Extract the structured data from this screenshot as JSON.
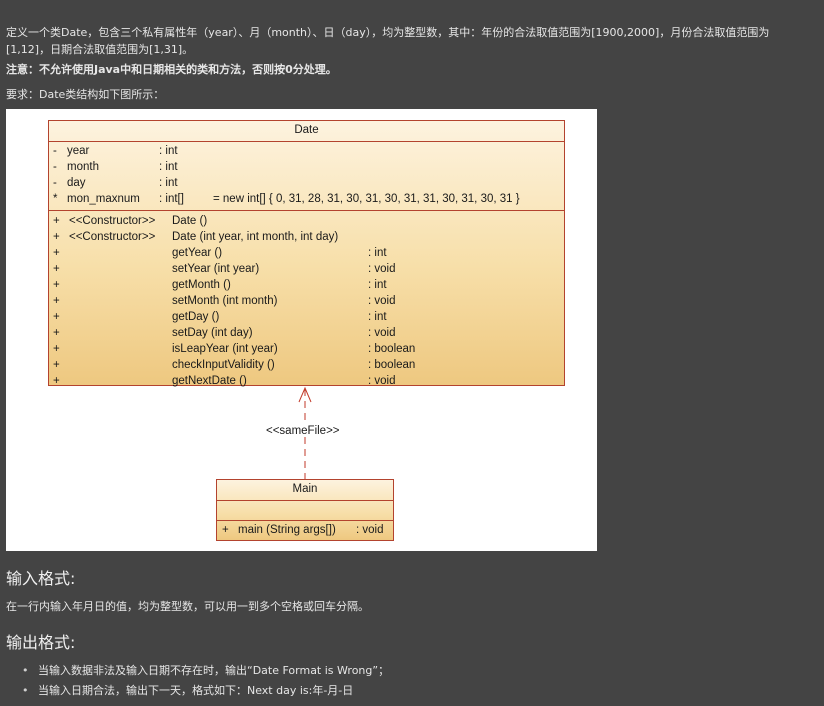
{
  "description": {
    "intro": "定义一个类Date，包含三个私有属性年（year）、月（month）、日（day），均为整型数，其中：年份的合法取值范围为[1900,2000]，月份合法取值范围为[1,12]，日期合法取值范围为[1,31]。",
    "note": "注意：不允许使用Java中和日期相关的类和方法，否则按0分处理。",
    "requirement": "要求：Date类结构如下图所示："
  },
  "diagram": {
    "date_class": {
      "title": "Date",
      "attributes": [
        {
          "vis": "-",
          "name": "year",
          "type": ": int",
          "extra": ""
        },
        {
          "vis": "-",
          "name": "month",
          "type": ": int",
          "extra": ""
        },
        {
          "vis": "-",
          "name": "day",
          "type": ": int",
          "extra": ""
        },
        {
          "vis": "*",
          "name": "mon_maxnum",
          "type": ": int[]",
          "extra": "= new int[] { 0, 31, 28, 31, 30, 31, 30, 31, 31, 30, 31, 30, 31 }"
        }
      ],
      "methods": [
        {
          "vis": "+",
          "stereo": "<<Constructor>>",
          "sig": "Date ()",
          "ret": ""
        },
        {
          "vis": "+",
          "stereo": "<<Constructor>>",
          "sig": "Date (int year, int month, int day)",
          "ret": ""
        },
        {
          "vis": "+",
          "stereo": "",
          "sig": "getYear ()",
          "ret": ": int"
        },
        {
          "vis": "+",
          "stereo": "",
          "sig": "setYear (int year)",
          "ret": ": void"
        },
        {
          "vis": "+",
          "stereo": "",
          "sig": "getMonth ()",
          "ret": ": int"
        },
        {
          "vis": "+",
          "stereo": "",
          "sig": "setMonth (int month)",
          "ret": ": void"
        },
        {
          "vis": "+",
          "stereo": "",
          "sig": "getDay ()",
          "ret": ": int"
        },
        {
          "vis": "+",
          "stereo": "",
          "sig": "setDay (int day)",
          "ret": ": void"
        },
        {
          "vis": "+",
          "stereo": "",
          "sig": "isLeapYear (int year)",
          "ret": ": boolean"
        },
        {
          "vis": "+",
          "stereo": "",
          "sig": "checkInputValidity ()",
          "ret": ": boolean"
        },
        {
          "vis": "+",
          "stereo": "",
          "sig": "getNextDate ()",
          "ret": ": void"
        }
      ]
    },
    "dependency_label": "<<sameFile>>",
    "main_class": {
      "title": "Main",
      "method": {
        "vis": "+",
        "sig": "main (String args[])",
        "ret": ": void"
      }
    }
  },
  "input_format": {
    "heading": "输入格式:",
    "text": "在一行内输入年月日的值，均为整型数，可以用一到多个空格或回车分隔。"
  },
  "output_format": {
    "heading": "输出格式:",
    "items": [
      "当输入数据非法及输入日期不存在时，输出“Date Format is Wrong”；",
      "当输入日期合法，输出下一天，格式如下：Next day is:年-月-日"
    ]
  }
}
